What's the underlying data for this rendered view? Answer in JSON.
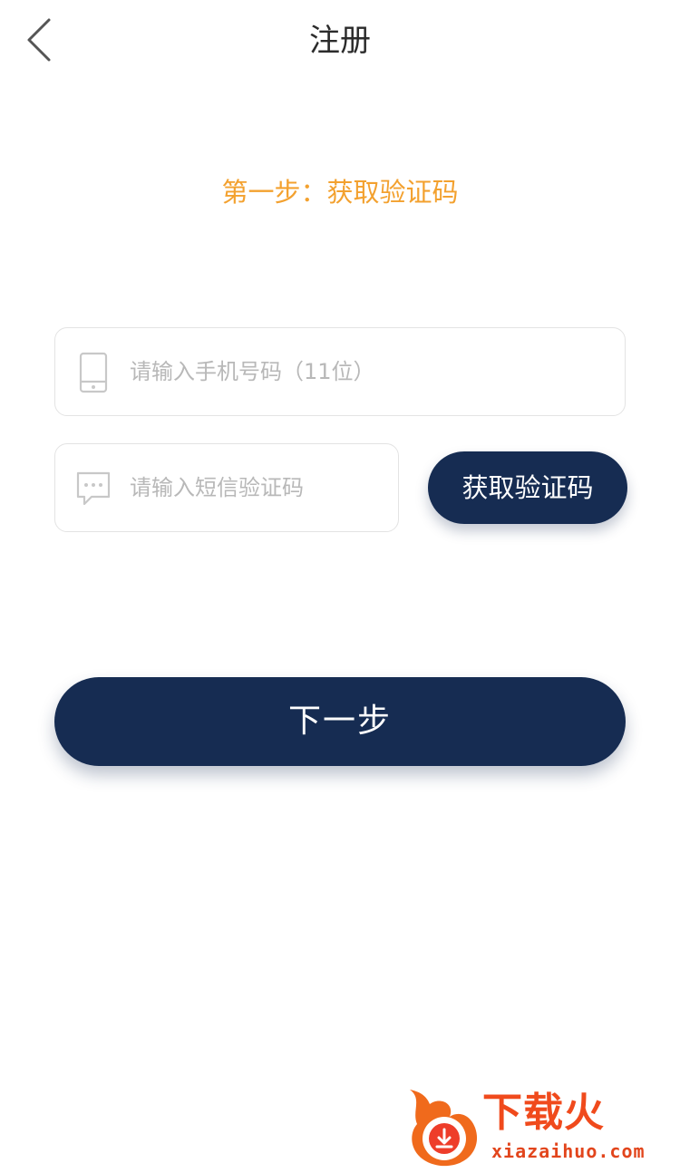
{
  "header": {
    "title": "注册",
    "back_icon": "chevron-left-icon"
  },
  "step": {
    "title": "第一步：获取验证码"
  },
  "phone_field": {
    "icon": "phone-icon",
    "placeholder": "请输入手机号码（11位）",
    "value": ""
  },
  "code_field": {
    "icon": "message-icon",
    "placeholder": "请输入短信验证码",
    "value": ""
  },
  "buttons": {
    "get_code_label": "获取验证码",
    "next_label": "下一步"
  },
  "watermark": {
    "brand": "下载火",
    "domain": "xiazaihuo.com"
  },
  "colors": {
    "primary": "#162c52",
    "accent": "#f3a12f",
    "placeholder": "#b8b8b8",
    "border": "#e3e3e3",
    "watermark": "#f04a1c"
  }
}
